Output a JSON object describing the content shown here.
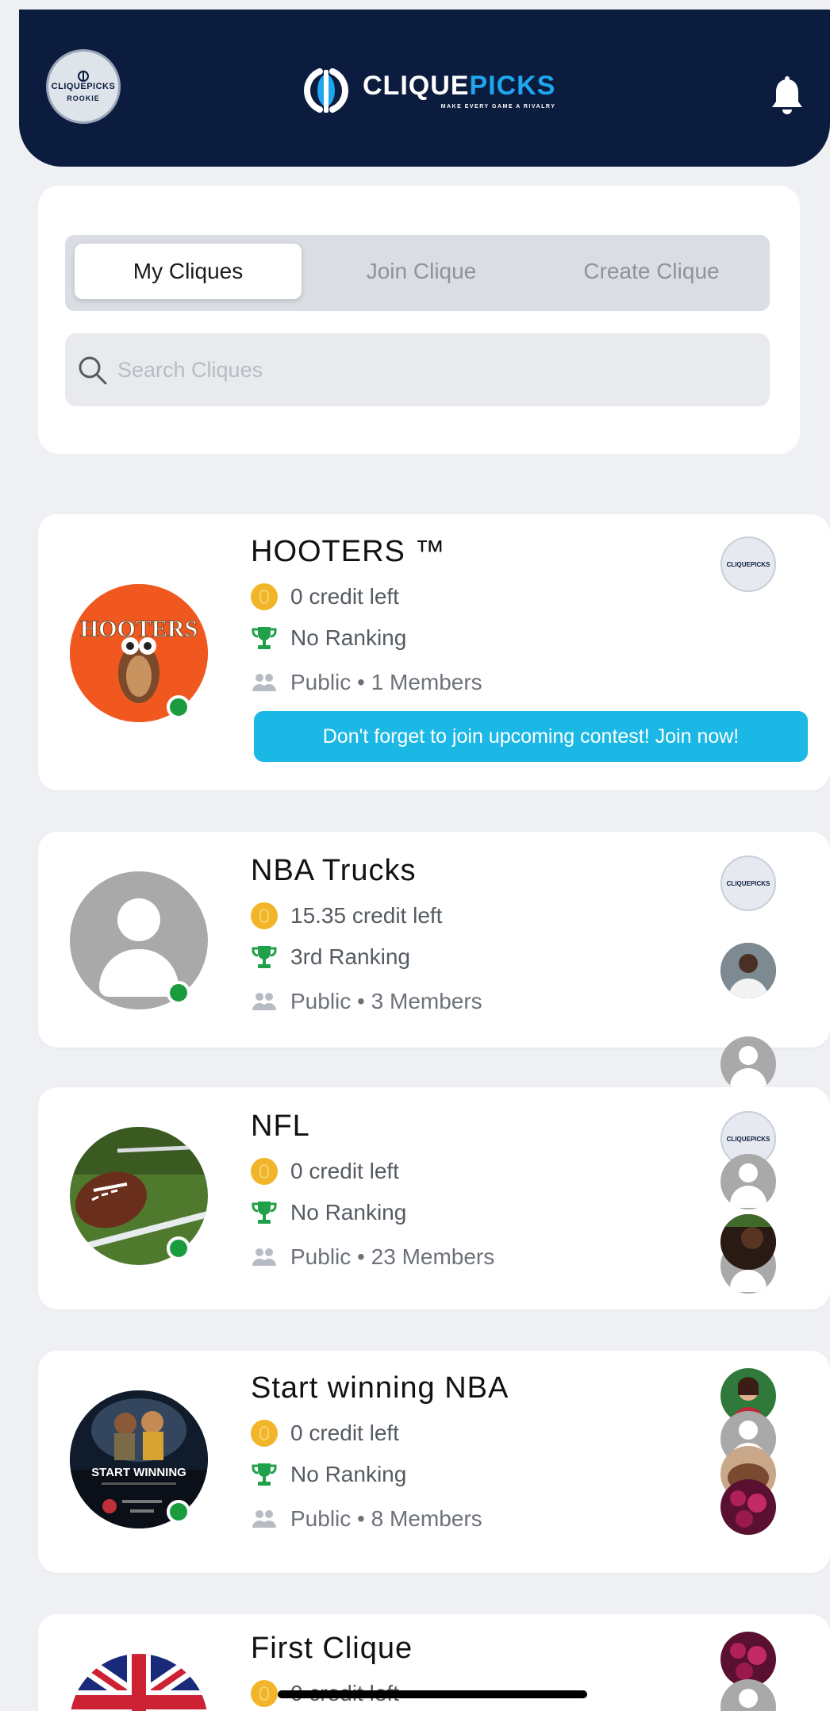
{
  "header": {
    "badge_logo": "CLIQUEPICKS",
    "badge_rank": "ROOKIE",
    "brand_name_a": "CLIQUE",
    "brand_name_b": "PICKS",
    "brand_tagline": "MAKE EVERY GAME A RIVALRY",
    "bell_icon": "bell-icon",
    "colors": {
      "header_bg": "#0b1c3f",
      "brand_accent": "#1ea7ef"
    }
  },
  "tabs": [
    {
      "label": "My Cliques",
      "active": true
    },
    {
      "label": "Join Clique",
      "active": false
    },
    {
      "label": "Create Clique",
      "active": false
    }
  ],
  "search": {
    "placeholder": "Search Cliques",
    "value": "",
    "icon": "search-icon"
  },
  "cliques": [
    {
      "name": "HOOTERS ™",
      "credit": "0 credit left",
      "ranking": "No Ranking",
      "visibility": "Public",
      "separator": "•",
      "members": "1 Members",
      "avatar_text": "HOOTERS",
      "banner": "Don't forget to join upcoming contest! Join now!"
    },
    {
      "name": "NBA Trucks",
      "credit": "15.35 credit left",
      "ranking": "3rd Ranking",
      "visibility": "Public",
      "separator": "•",
      "members": "3 Members"
    },
    {
      "name": "NFL",
      "credit": "0 credit left",
      "ranking": "No Ranking",
      "visibility": "Public",
      "separator": "•",
      "members": "23 Members"
    },
    {
      "name": "Start winning NBA",
      "credit": "0 credit left",
      "ranking": "No Ranking",
      "visibility": "Public",
      "separator": "•",
      "members": "8 Members",
      "avatar_text": "START WINNING"
    },
    {
      "name": "First Clique",
      "credit": "0 credit left"
    }
  ],
  "status_colors": {
    "online": "#1a9c3e",
    "coin": "#f2b52a",
    "trophy": "#21a04a",
    "banner": "#1bb7e5"
  }
}
